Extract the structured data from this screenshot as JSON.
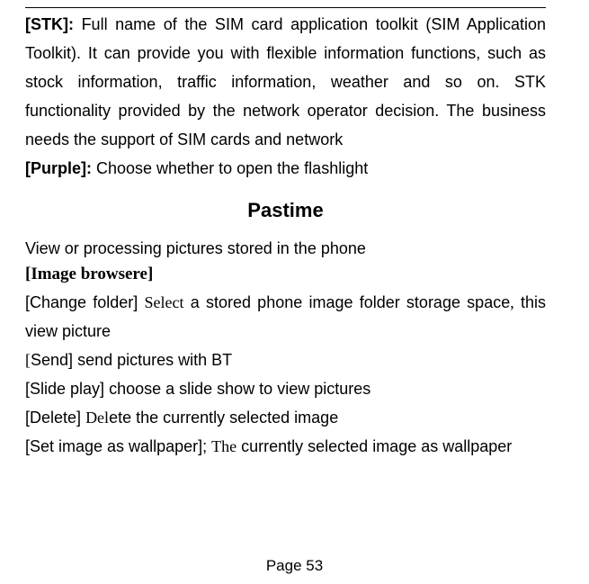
{
  "stk": {
    "label": "[STK]:",
    "text": "Full name of the SIM card application toolkit (SIM Application Toolkit). It can provide you with flexible information functions, such as stock information, traffic information, weather and so on. STK functionality provided by the network operator decision. The business needs the support of SIM cards and network"
  },
  "purple": {
    "label": "[Purple]:",
    "text": "Choose whether to open the flashlight"
  },
  "section_heading": "Pastime",
  "intro": "View or processing pictures stored in the phone",
  "image_browser_heading": "[Image browsere]",
  "change_folder": {
    "label": "[Change folder]",
    "lead": "Select",
    "rest": "a stored phone image folder storage space",
    "tail": "this view picture"
  },
  "send": {
    "label": "[",
    "label2": "Send]",
    "text": "send pictures with BT"
  },
  "slide": {
    "label": "[Slide play]",
    "text": "choose a slide show to view pictures"
  },
  "delete": {
    "label": "[Delete]",
    "lead": "Del",
    "rest": "ete the currently selected image"
  },
  "wallpaper": {
    "label": "[Set image as wallpaper];",
    "lead": "The",
    "rest": "currently selected image as wallpaper"
  },
  "page_number": "Page 53"
}
